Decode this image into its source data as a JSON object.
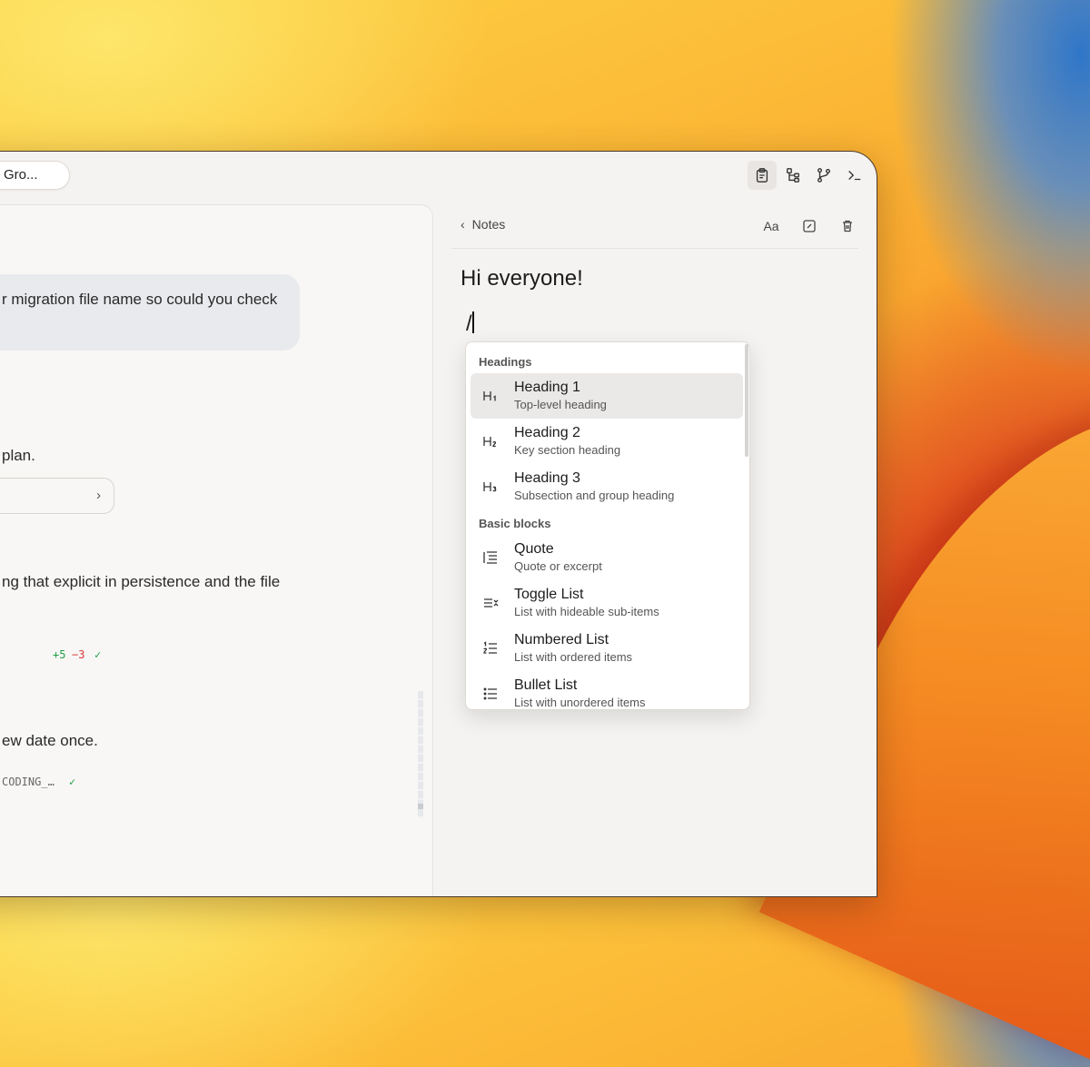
{
  "titlebar": {
    "pill_label": "Gro...",
    "icons": [
      "clipboard-icon",
      "tree-icon",
      "branch-icon",
      "terminal-icon"
    ]
  },
  "chat": {
    "bubble_text": "r migration file name so could you check",
    "plan_text": "plan.",
    "explicit_text": "ng that explicit in persistence and the file",
    "diff_add": "+5",
    "diff_del": "−3",
    "check": "✓",
    "review_text": "ew date once.",
    "coding_text": "CODING_…",
    "colors": {
      "add": "#1f9d45",
      "del": "#d73a3a",
      "check": "#1f9d45"
    }
  },
  "notes": {
    "back_label": "Notes",
    "title": "Hi everyone!",
    "input": "/"
  },
  "menu": {
    "sections": [
      {
        "label": "Headings",
        "items": [
          {
            "title": "Heading 1",
            "desc": "Top-level heading",
            "icon": "heading1-icon",
            "selected": true
          },
          {
            "title": "Heading 2",
            "desc": "Key section heading",
            "icon": "heading2-icon"
          },
          {
            "title": "Heading 3",
            "desc": "Subsection and group heading",
            "icon": "heading3-icon"
          }
        ]
      },
      {
        "label": "Basic blocks",
        "items": [
          {
            "title": "Quote",
            "desc": "Quote or excerpt",
            "icon": "quote-icon"
          },
          {
            "title": "Toggle List",
            "desc": "List with hideable sub-items",
            "icon": "toggle-list-icon"
          },
          {
            "title": "Numbered List",
            "desc": "List with ordered items",
            "icon": "numbered-list-icon"
          },
          {
            "title": "Bullet List",
            "desc": "List with unordered items",
            "icon": "bullet-list-icon"
          }
        ]
      }
    ]
  }
}
